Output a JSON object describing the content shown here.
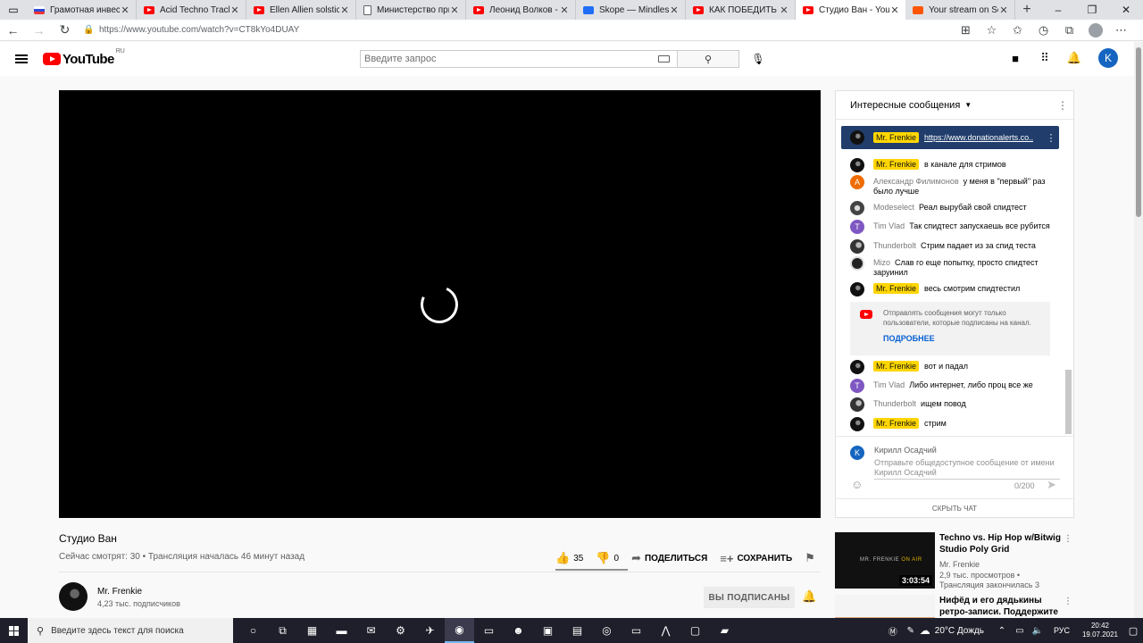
{
  "browser": {
    "tabs": [
      {
        "label": "Грамотная инвестиция",
        "favicon": "flag"
      },
      {
        "label": "Acid Techno Track Break",
        "favicon": "youtube"
      },
      {
        "label": "Ellen Allien solstice techno",
        "favicon": "youtube"
      },
      {
        "label": "Министерство природы",
        "favicon": "document"
      },
      {
        "label": "Леонид Волков - YouTube",
        "favicon": "youtube"
      },
      {
        "label": "Skope — Mindless",
        "favicon": "skope"
      },
      {
        "label": "КАК ПОБЕДИТЬ ЕДИНУЮ",
        "favicon": "youtube"
      },
      {
        "label": "Студио Ван - YouTube",
        "favicon": "youtube",
        "active": true
      },
      {
        "label": "Your stream on SoundCloud",
        "favicon": "soundcloud"
      }
    ],
    "url": "https://www.youtube.com/watch?v=CT8kYo4DUAY"
  },
  "youtube": {
    "region": "RU",
    "logo_text": "YouTube",
    "search_placeholder": "Введите запрос",
    "avatar_letter": "K"
  },
  "video": {
    "title": "Студио Ван",
    "viewers": "Сейчас смотрят: 30",
    "started": "Трансляция началась 46 минут назад",
    "likes": "35",
    "dislikes": "0",
    "share_label": "ПОДЕЛИТЬСЯ",
    "save_label": "СОХРАНИТЬ"
  },
  "channel": {
    "name": "Mr. Frenkie",
    "subscribers": "4,23 тыс. подписчиков",
    "subscribed_label": "ВЫ ПОДПИСАНЫ"
  },
  "chat": {
    "header": "Интересные сообщения",
    "pinned": {
      "author": "Mr. Frenkie",
      "text": "https://www.donationalerts.co..."
    },
    "messages": [
      {
        "author": "Mr. Frenkie",
        "owner": true,
        "text": "в канале для стримов",
        "avatar": "dark"
      },
      {
        "author": "Александр Филимонов",
        "owner": false,
        "text": "у меня в \"первый\" раз было лучше",
        "avatar": "orange",
        "letter": "А"
      },
      {
        "author": "Modeselect",
        "owner": false,
        "text": "Реал вырубай свой спидтест",
        "avatar": "gray"
      },
      {
        "author": "Tim Vlad",
        "owner": false,
        "text": "Так спидтест запускаешь все рубится",
        "avatar": "purple",
        "letter": "T"
      },
      {
        "author": "Thunderbolt",
        "owner": false,
        "text": "Стрим падает из за спид теста",
        "avatar": "grayb"
      },
      {
        "author": "Mizo",
        "owner": false,
        "text": "Слав го еще попытку, просто спидтест заруинил",
        "avatar": "ring"
      },
      {
        "author": "Mr. Frenkie",
        "owner": true,
        "text": "весь смотрим спидтестил",
        "avatar": "dark"
      },
      {
        "author": "Mr. Frenkie",
        "owner": true,
        "text": "вот и падал",
        "avatar": "dark"
      },
      {
        "author": "Tim Vlad",
        "owner": false,
        "text": "Либо интернет, либо проц все же",
        "avatar": "purple",
        "letter": "T"
      },
      {
        "author": "Thunderbolt",
        "owner": false,
        "text": "ищем повод",
        "avatar": "grayb"
      },
      {
        "author": "Mr. Frenkie",
        "owner": true,
        "text": "стрим",
        "avatar": "dark"
      }
    ],
    "notice_text": "Отправлять сообщения могут только пользователи, которые подписаны на канал.",
    "notice_link": "ПОДРОБНЕЕ",
    "composer": {
      "user": "Кирилл Осадчий",
      "letter": "K",
      "placeholder": "Отправьте общедоступное сообщение от имени Кирилл Осадчий",
      "counter": "0/200"
    },
    "hide_label": "СКРЫТЬ ЧАТ"
  },
  "recommendations": [
    {
      "title": "Techno vs. Hip Hop w/Bitwig Studio Poly Grid",
      "channel": "Mr. Frenkie",
      "views": "2,9 тыс. просмотров •",
      "note": "Трансляция закончилась 3",
      "duration": "3:03:54",
      "brand_a": "MR. FRENKIE",
      "brand_b": "ON AIR"
    },
    {
      "title": "Нифёд и его дядькины ретро-записи. Поддержите ..."
    }
  ],
  "taskbar": {
    "search_placeholder": "Введите здесь текст для поиска",
    "weather": "20°C Дождь",
    "lang": "РУС",
    "time": "20:42",
    "date": "19.07.2021"
  }
}
